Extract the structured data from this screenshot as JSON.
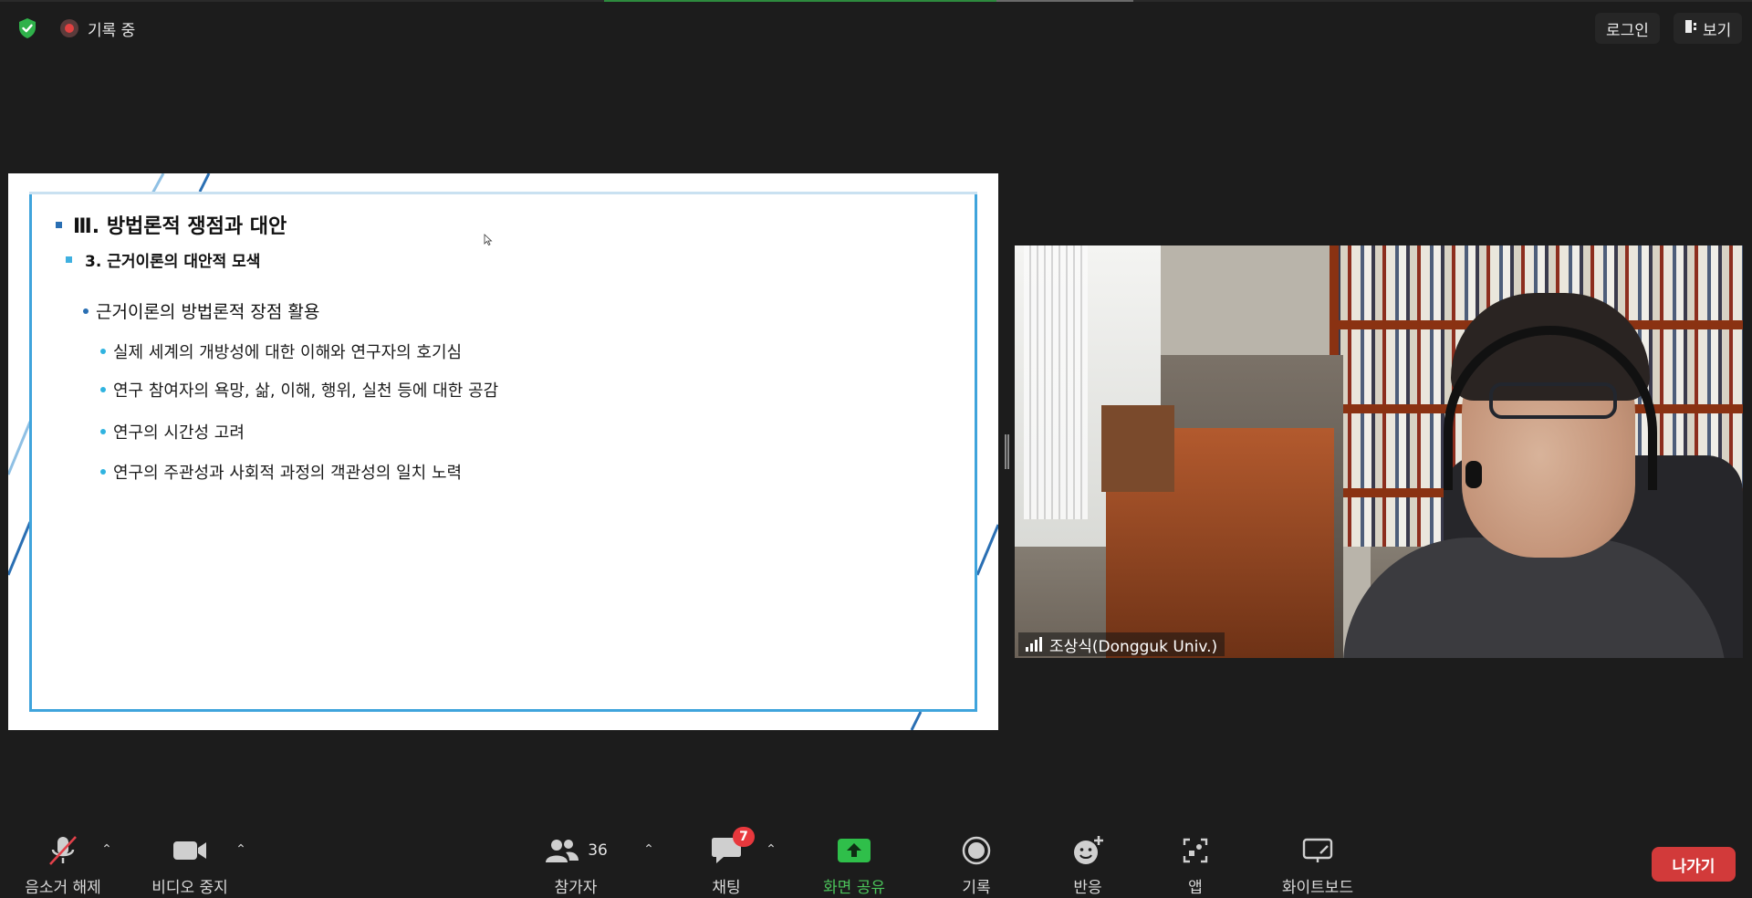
{
  "top_bar": {
    "recording_text": "기록 중",
    "login_label": "로그인",
    "view_label": "보기"
  },
  "slide": {
    "heading": "Ⅲ. 방법론적 쟁점과 대안",
    "subheading": "3. 근거이론의 대안적 모색",
    "bullet_main": "근거이론의 방법론적 장점 활용",
    "bullets": [
      "실제 세계의 개방성에 대한 이해와 연구자의 호기심",
      "연구 참여자의 욕망, 삶, 이해, 행위, 실천 등에 대한 공감",
      "연구의 시간성 고려",
      "연구의 주관성과 사회적 과정의 객관성의 일치 노력"
    ]
  },
  "video": {
    "participant_name": "조상식(Dongguk Univ.)"
  },
  "toolbar": {
    "unmute_label": "음소거 해제",
    "stop_video_label": "비디오 중지",
    "participants_label": "참가자",
    "participants_count": "36",
    "chat_label": "채팅",
    "chat_badge": "7",
    "share_label": "화면 공유",
    "record_label": "기록",
    "reactions_label": "반응",
    "apps_label": "앱",
    "whiteboard_label": "화이트보드",
    "leave_label": "나가기"
  },
  "colors": {
    "background": "#1c1c1c",
    "share_green": "#2fbf4a",
    "leave_red": "#d23a3a",
    "badge_red": "#e8383d",
    "slide_accent": "#3fa4dc"
  }
}
